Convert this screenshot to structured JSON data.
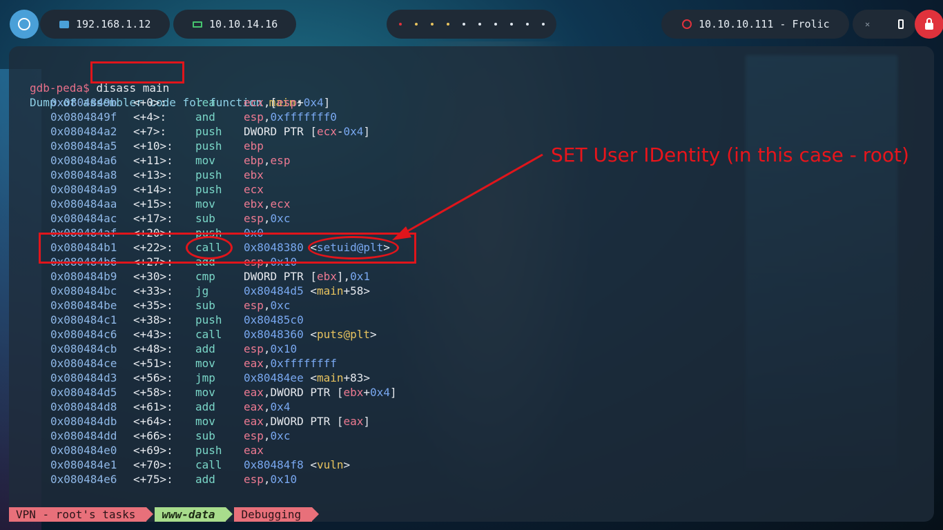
{
  "topbar": {
    "lan_ip": "192.168.1.12",
    "vpn_ip": "10.10.14.16",
    "target": "10.10.10.111 - Frolic",
    "workspace_count": 10
  },
  "terminal": {
    "prompt": "gdb-peda$",
    "command": " disass main",
    "header_prefix": "Dump of assembler code for function ",
    "header_fn": "main",
    "header_suffix": ":",
    "rows": [
      {
        "addr": "0x0804849b",
        "off": "<+0>:",
        "op": "lea",
        "args": [
          [
            "pink",
            "ecx"
          ],
          [
            "wht",
            ",["
          ],
          [
            "pink",
            "esp"
          ],
          [
            "wht",
            "+"
          ],
          [
            "num",
            "0x4"
          ],
          [
            "wht",
            "]"
          ]
        ]
      },
      {
        "addr": "0x0804849f",
        "off": "<+4>:",
        "op": "and",
        "args": [
          [
            "pink",
            "esp"
          ],
          [
            "wht",
            ","
          ],
          [
            "num",
            "0xfffffff0"
          ]
        ]
      },
      {
        "addr": "0x080484a2",
        "off": "<+7>:",
        "op": "push",
        "args": [
          [
            "wht",
            "DWORD PTR ["
          ],
          [
            "pink",
            "ecx"
          ],
          [
            "wht",
            "-"
          ],
          [
            "num",
            "0x4"
          ],
          [
            "wht",
            "]"
          ]
        ]
      },
      {
        "addr": "0x080484a5",
        "off": "<+10>:",
        "op": "push",
        "args": [
          [
            "pink",
            "ebp"
          ]
        ]
      },
      {
        "addr": "0x080484a6",
        "off": "<+11>:",
        "op": "mov",
        "args": [
          [
            "pink",
            "ebp"
          ],
          [
            "wht",
            ","
          ],
          [
            "pink",
            "esp"
          ]
        ]
      },
      {
        "addr": "0x080484a8",
        "off": "<+13>:",
        "op": "push",
        "args": [
          [
            "pink",
            "ebx"
          ]
        ]
      },
      {
        "addr": "0x080484a9",
        "off": "<+14>:",
        "op": "push",
        "args": [
          [
            "pink",
            "ecx"
          ]
        ]
      },
      {
        "addr": "0x080484aa",
        "off": "<+15>:",
        "op": "mov",
        "args": [
          [
            "pink",
            "ebx"
          ],
          [
            "wht",
            ","
          ],
          [
            "pink",
            "ecx"
          ]
        ]
      },
      {
        "addr": "0x080484ac",
        "off": "<+17>:",
        "op": "sub",
        "args": [
          [
            "pink",
            "esp"
          ],
          [
            "wht",
            ","
          ],
          [
            "num",
            "0xc"
          ]
        ]
      },
      {
        "addr": "0x080484af",
        "off": "<+20>:",
        "op": "push",
        "args": [
          [
            "num",
            "0x0"
          ]
        ]
      },
      {
        "addr": "0x080484b1",
        "off": "<+22>:",
        "op": "call",
        "args": [
          [
            "num",
            "0x8048380 "
          ],
          [
            "wht",
            "<"
          ],
          [
            "num",
            "setuid@plt"
          ],
          [
            "wht",
            ">"
          ]
        ]
      },
      {
        "addr": "0x080484b6",
        "off": "<+27>:",
        "op": "add",
        "args": [
          [
            "pink",
            "esp"
          ],
          [
            "wht",
            ","
          ],
          [
            "num",
            "0x10"
          ]
        ]
      },
      {
        "addr": "0x080484b9",
        "off": "<+30>:",
        "op": "cmp",
        "args": [
          [
            "wht",
            "DWORD PTR ["
          ],
          [
            "pink",
            "ebx"
          ],
          [
            "wht",
            "],"
          ],
          [
            "num",
            "0x1"
          ]
        ]
      },
      {
        "addr": "0x080484bc",
        "off": "<+33>:",
        "op": "jg",
        "args": [
          [
            "num",
            "0x80484d5 "
          ],
          [
            "wht",
            "<"
          ],
          [
            "yel",
            "main"
          ],
          [
            "wht",
            "+58>"
          ]
        ]
      },
      {
        "addr": "0x080484be",
        "off": "<+35>:",
        "op": "sub",
        "args": [
          [
            "pink",
            "esp"
          ],
          [
            "wht",
            ","
          ],
          [
            "num",
            "0xc"
          ]
        ]
      },
      {
        "addr": "0x080484c1",
        "off": "<+38>:",
        "op": "push",
        "args": [
          [
            "num",
            "0x80485c0"
          ]
        ]
      },
      {
        "addr": "0x080484c6",
        "off": "<+43>:",
        "op": "call",
        "args": [
          [
            "num",
            "0x8048360 "
          ],
          [
            "wht",
            "<"
          ],
          [
            "yel",
            "puts@plt"
          ],
          [
            "wht",
            ">"
          ]
        ]
      },
      {
        "addr": "0x080484cb",
        "off": "<+48>:",
        "op": "add",
        "args": [
          [
            "pink",
            "esp"
          ],
          [
            "wht",
            ","
          ],
          [
            "num",
            "0x10"
          ]
        ]
      },
      {
        "addr": "0x080484ce",
        "off": "<+51>:",
        "op": "mov",
        "args": [
          [
            "pink",
            "eax"
          ],
          [
            "wht",
            ","
          ],
          [
            "num",
            "0xffffffff"
          ]
        ]
      },
      {
        "addr": "0x080484d3",
        "off": "<+56>:",
        "op": "jmp",
        "args": [
          [
            "num",
            "0x80484ee "
          ],
          [
            "wht",
            "<"
          ],
          [
            "yel",
            "main"
          ],
          [
            "wht",
            "+83>"
          ]
        ]
      },
      {
        "addr": "0x080484d5",
        "off": "<+58>:",
        "op": "mov",
        "args": [
          [
            "pink",
            "eax"
          ],
          [
            "wht",
            ",DWORD PTR ["
          ],
          [
            "pink",
            "ebx"
          ],
          [
            "wht",
            "+"
          ],
          [
            "num",
            "0x4"
          ],
          [
            "wht",
            "]"
          ]
        ]
      },
      {
        "addr": "0x080484d8",
        "off": "<+61>:",
        "op": "add",
        "args": [
          [
            "pink",
            "eax"
          ],
          [
            "wht",
            ","
          ],
          [
            "num",
            "0x4"
          ]
        ]
      },
      {
        "addr": "0x080484db",
        "off": "<+64>:",
        "op": "mov",
        "args": [
          [
            "pink",
            "eax"
          ],
          [
            "wht",
            ",DWORD PTR ["
          ],
          [
            "pink",
            "eax"
          ],
          [
            "wht",
            "]"
          ]
        ]
      },
      {
        "addr": "0x080484dd",
        "off": "<+66>:",
        "op": "sub",
        "args": [
          [
            "pink",
            "esp"
          ],
          [
            "wht",
            ","
          ],
          [
            "num",
            "0xc"
          ]
        ]
      },
      {
        "addr": "0x080484e0",
        "off": "<+69>:",
        "op": "push",
        "args": [
          [
            "pink",
            "eax"
          ]
        ]
      },
      {
        "addr": "0x080484e1",
        "off": "<+70>:",
        "op": "call",
        "args": [
          [
            "num",
            "0x80484f8 "
          ],
          [
            "wht",
            "<"
          ],
          [
            "yel",
            "vuln"
          ],
          [
            "wht",
            ">"
          ]
        ]
      },
      {
        "addr": "0x080484e6",
        "off": "<+75>:",
        "op": "add",
        "args": [
          [
            "pink",
            "esp"
          ],
          [
            "wht",
            ","
          ],
          [
            "num",
            "0x10"
          ]
        ]
      }
    ]
  },
  "annotation": {
    "text": "SET User IDentity (in this case - root)",
    "color": "#e0151b"
  },
  "statusbar": {
    "seg1": "VPN - root's tasks",
    "seg2": "www-data",
    "seg3": "Debugging"
  }
}
